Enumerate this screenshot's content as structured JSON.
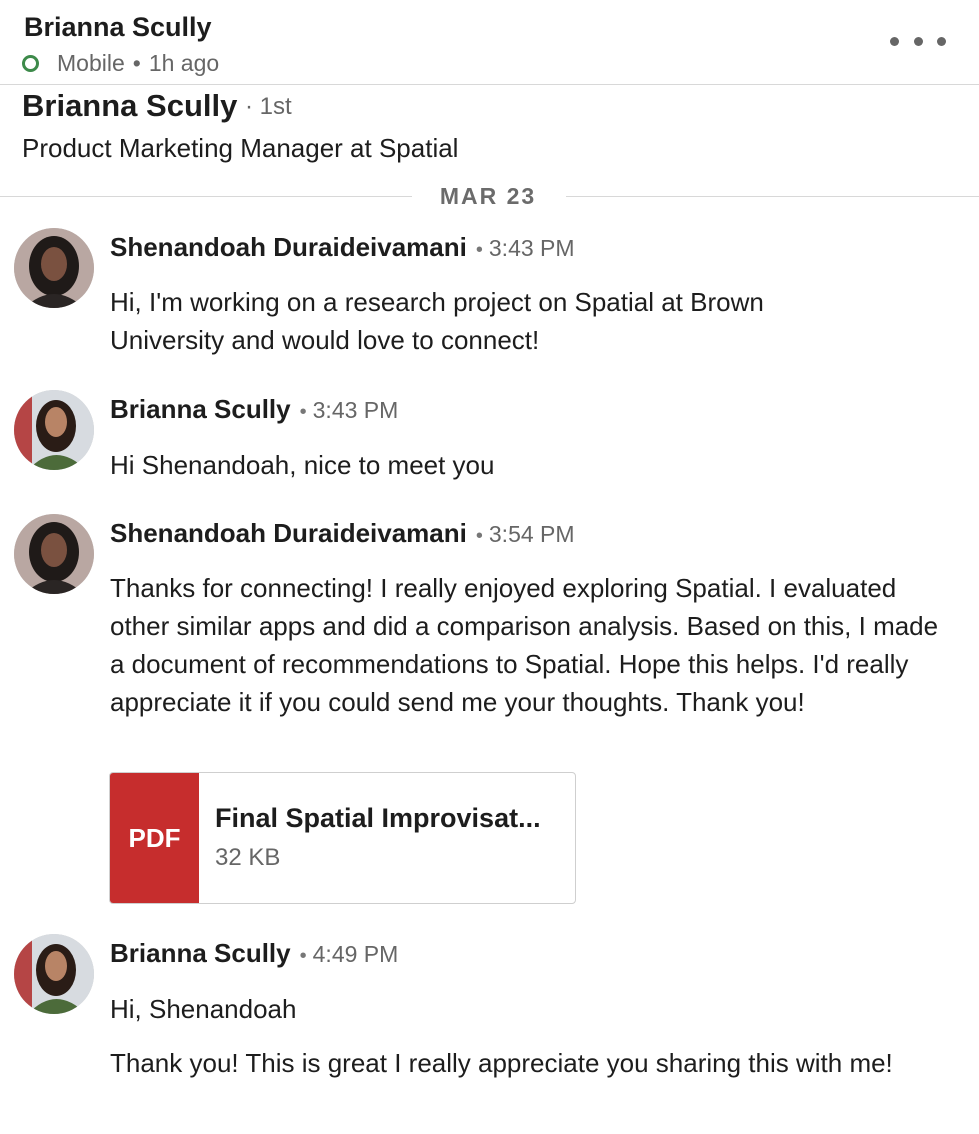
{
  "header": {
    "name": "Brianna Scully",
    "status": "Mobile",
    "last_active": "1h ago",
    "status_color": "#3d8a4a"
  },
  "profile": {
    "name": "Brianna Scully",
    "degree": "· 1st",
    "headline": "Product Marketing Manager at Spatial"
  },
  "date_divider": "MAR 23",
  "messages": [
    {
      "sender": "Shenandoah Duraideivamani",
      "time": "3:43 PM",
      "paragraphs": [
        "Hi, I'm working on a research project on Spatial at Brown University and would love to connect!"
      ]
    },
    {
      "sender": "Brianna Scully",
      "time": "3:43 PM",
      "paragraphs": [
        "Hi Shenandoah, nice to meet you"
      ]
    },
    {
      "sender": "Shenandoah Duraideivamani",
      "time": "3:54 PM",
      "paragraphs": [
        "Thanks for connecting! I really enjoyed exploring Spatial. I evaluated other similar apps and did a comparison analysis. Based on this, I made a document of recommendations to Spatial. Hope this helps. I'd really appreciate it if you could send me your thoughts. Thank you!"
      ],
      "attachment": {
        "type_label": "PDF",
        "name": "Final Spatial Improvisat...",
        "size": "32 KB",
        "color": "#c62d2d"
      }
    },
    {
      "sender": "Brianna Scully",
      "time": "4:49 PM",
      "paragraphs": [
        "Hi, Shenandoah",
        "Thank you! This is great I really appreciate you sharing this with me!"
      ]
    }
  ]
}
